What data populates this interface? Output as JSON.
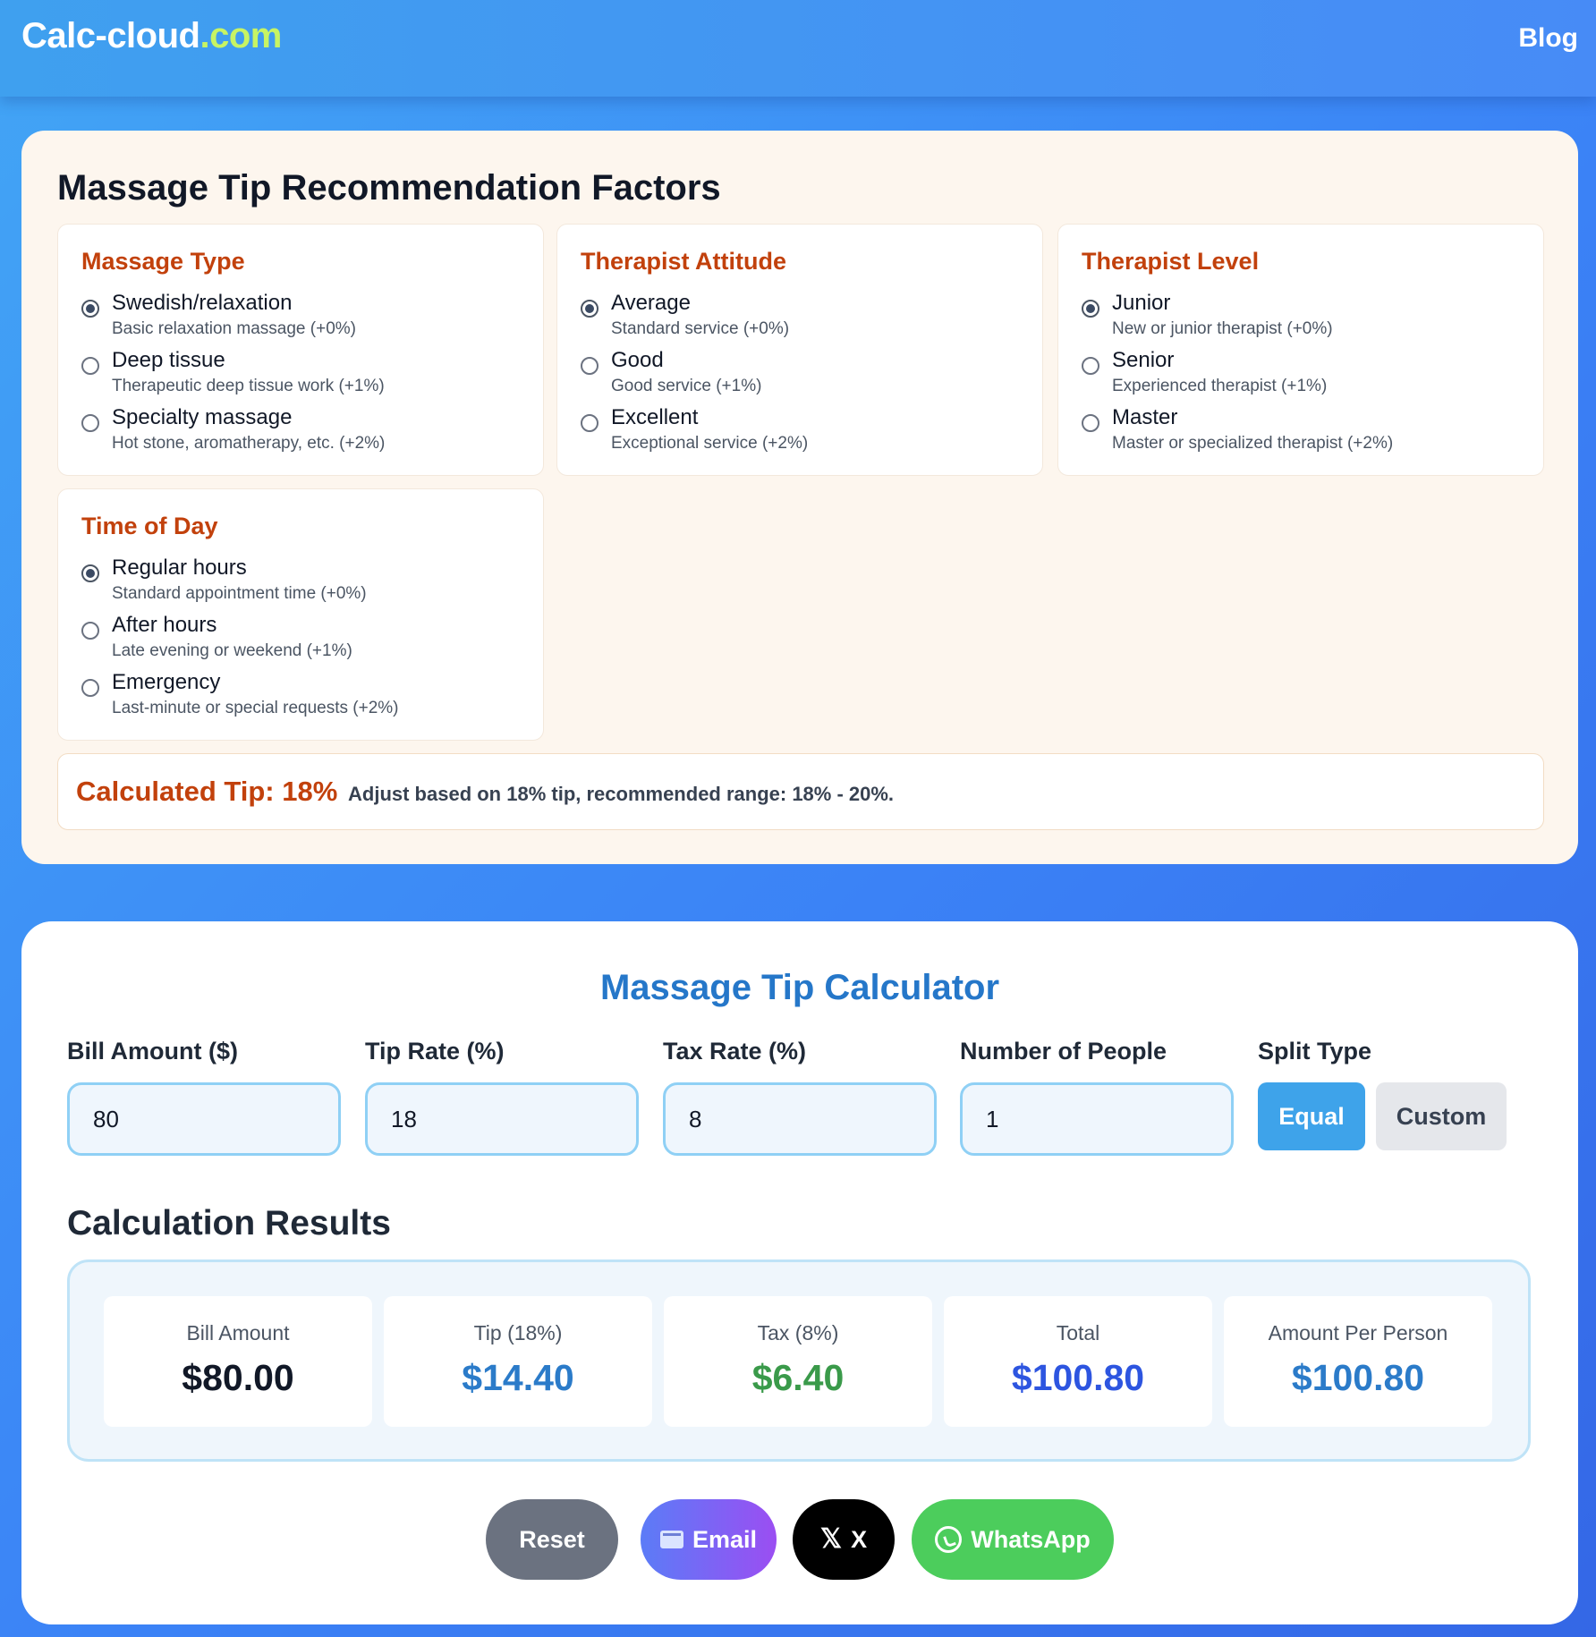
{
  "header": {
    "brand_main": "Calc-cloud",
    "brand_tld": ".com",
    "blog_link": "Blog"
  },
  "factors": {
    "title": "Massage Tip Recommendation Factors",
    "groups": [
      {
        "title": "Massage Type",
        "options": [
          {
            "label": "Swedish/relaxation",
            "desc": "Basic relaxation massage (+0%)",
            "selected": true
          },
          {
            "label": "Deep tissue",
            "desc": "Therapeutic deep tissue work (+1%)",
            "selected": false
          },
          {
            "label": "Specialty massage",
            "desc": "Hot stone, aromatherapy, etc. (+2%)",
            "selected": false
          }
        ]
      },
      {
        "title": "Therapist Attitude",
        "options": [
          {
            "label": "Average",
            "desc": "Standard service (+0%)",
            "selected": true
          },
          {
            "label": "Good",
            "desc": "Good service (+1%)",
            "selected": false
          },
          {
            "label": "Excellent",
            "desc": "Exceptional service (+2%)",
            "selected": false
          }
        ]
      },
      {
        "title": "Therapist Level",
        "options": [
          {
            "label": "Junior",
            "desc": "New or junior therapist (+0%)",
            "selected": true
          },
          {
            "label": "Senior",
            "desc": "Experienced therapist (+1%)",
            "selected": false
          },
          {
            "label": "Master",
            "desc": "Master or specialized therapist (+2%)",
            "selected": false
          }
        ]
      },
      {
        "title": "Time of Day",
        "options": [
          {
            "label": "Regular hours",
            "desc": "Standard appointment time (+0%)",
            "selected": true
          },
          {
            "label": "After hours",
            "desc": "Late evening or weekend (+1%)",
            "selected": false
          },
          {
            "label": "Emergency",
            "desc": "Last-minute or special requests (+2%)",
            "selected": false
          }
        ]
      }
    ],
    "calculated_tip": "Calculated Tip: 18%",
    "calculated_note": "Adjust based on 18% tip, recommended range: 18% - 20%."
  },
  "calculator": {
    "title": "Massage Tip Calculator",
    "fields": [
      {
        "label": "Bill Amount ($)",
        "value": "80"
      },
      {
        "label": "Tip Rate (%)",
        "value": "18"
      },
      {
        "label": "Tax Rate (%)",
        "value": "8"
      },
      {
        "label": "Number of People",
        "value": "1"
      }
    ],
    "split_type": {
      "label": "Split Type",
      "equal_label": "Equal",
      "custom_label": "Custom",
      "selected": "Equal"
    },
    "results_title": "Calculation Results",
    "results": [
      {
        "label": "Bill Amount",
        "value": "$80.00",
        "color": "#111827"
      },
      {
        "label": "Tip (18%)",
        "value": "$14.40",
        "color": "#2b7bc9"
      },
      {
        "label": "Tax (8%)",
        "value": "$6.40",
        "color": "#3a9a4a"
      },
      {
        "label": "Total",
        "value": "$100.80",
        "color": "#2d55e0"
      },
      {
        "label": "Amount Per Person",
        "value": "$100.80",
        "color": "#2b7bc9"
      }
    ],
    "actions": {
      "reset": "Reset",
      "email": "Email",
      "x": "X",
      "whatsapp": "WhatsApp"
    }
  },
  "colors": {
    "accent_orange": "#c2410c",
    "accent_blue": "#2577c9",
    "equal_button": "#3ea3ea",
    "whatsapp_green": "#4ccd5c"
  },
  "icons": [
    "envelope-icon",
    "x-logo-icon",
    "whatsapp-icon",
    "radio-icon"
  ]
}
